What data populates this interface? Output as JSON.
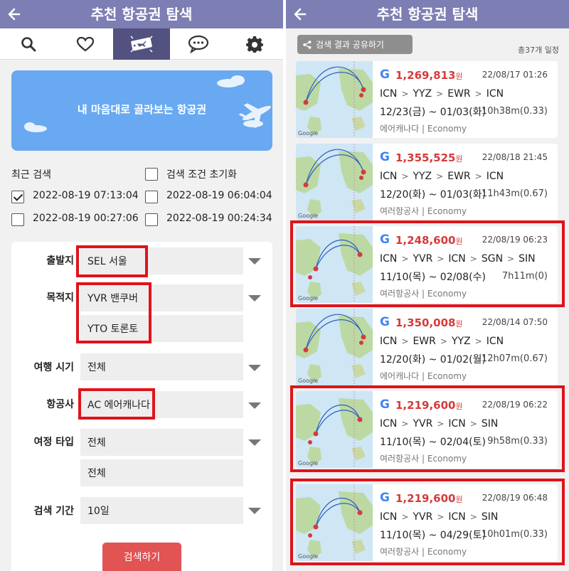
{
  "left": {
    "header_title": "추천 항공권 탐색",
    "banner_text": "내 마음대로 골라보는 항공권",
    "recent_label": "최근 검색",
    "reset_label": "검색 조건 초기화",
    "recent": [
      {
        "text": "2022-08-19 07:13:04",
        "checked": true
      },
      {
        "text": "2022-08-19 06:04:04",
        "checked": false
      },
      {
        "text": "2022-08-19 00:27:06",
        "checked": false
      },
      {
        "text": "2022-08-19 00:24:34",
        "checked": false
      }
    ],
    "form": {
      "origin_label": "출발지",
      "origin_value": "SEL 서울",
      "dest_label": "목적지",
      "dest_value_1": "YVR 밴쿠버",
      "dest_value_2": "YTO 토론토",
      "time_label": "여행 시기",
      "time_value": "전체",
      "airline_label": "항공사",
      "airline_value": "AC 에어캐나다",
      "triptype_label": "여정 타입",
      "triptype_value_1": "전체",
      "triptype_value_2": "전체",
      "period_label": "검색 기간",
      "period_value": "10일",
      "search_button": "검색하기"
    }
  },
  "right": {
    "header_title": "추천 항공권 탐색",
    "share_label": "검색 결과 공유하기",
    "total_label": "총37개 일정",
    "results": [
      {
        "price": "1,269,813",
        "won": "원",
        "date": "22/08/17 01:26",
        "route": [
          "ICN",
          "YYZ",
          "EWR",
          "ICN"
        ],
        "period": "12/23(금) ~ 01/03(화)",
        "duration": "10h38m(0.33)",
        "airline": "에어캐나다 | Economy",
        "highlight": false
      },
      {
        "price": "1,355,525",
        "won": "원",
        "date": "22/08/18 21:45",
        "route": [
          "ICN",
          "YYZ",
          "EWR",
          "ICN"
        ],
        "period": "12/20(화) ~ 01/03(화)",
        "duration": "11h43m(0.67)",
        "airline": "여러항공사 | Economy",
        "highlight": false
      },
      {
        "price": "1,248,600",
        "won": "원",
        "date": "22/08/19 06:23",
        "route": [
          "ICN",
          "YVR",
          "ICN",
          "SGN",
          "SIN"
        ],
        "period": "11/10(목) ~ 02/08(수)",
        "duration": "7h11m(0)",
        "airline": "여러항공사 | Economy",
        "highlight": true
      },
      {
        "price": "1,350,008",
        "won": "원",
        "date": "22/08/14 07:50",
        "route": [
          "ICN",
          "EWR",
          "YYZ",
          "ICN"
        ],
        "period": "12/20(화) ~ 01/02(월)",
        "duration": "12h07m(0.67)",
        "airline": "에어캐나다 | Economy",
        "highlight": false
      },
      {
        "price": "1,219,600",
        "won": "원",
        "date": "22/08/19 06:22",
        "route": [
          "ICN",
          "YVR",
          "ICN",
          "SIN"
        ],
        "period": "11/10(목) ~ 02/04(토)",
        "duration": "9h58m(0.33)",
        "airline": "여러항공사 | Economy",
        "highlight": true
      },
      {
        "price": "1,219,600",
        "won": "원",
        "date": "22/08/19 06:48",
        "route": [
          "ICN",
          "YVR",
          "ICN",
          "SIN"
        ],
        "period": "11/10(목) ~ 04/29(토)",
        "duration": "10h01m(0.33)",
        "airline": "여러항공사 | Economy",
        "highlight": true
      }
    ],
    "google_tag": "Google"
  },
  "colors": {
    "header": "#7d7eb3",
    "active_tab": "#53517f",
    "banner": "#69a9f1",
    "price": "#d63a3a",
    "highlight": "#e0131b",
    "search_button": "#e25353"
  },
  "icons": [
    "back-arrow-icon",
    "search-icon",
    "heart-icon",
    "ticket-icon",
    "chat-icon",
    "gear-icon",
    "share-icon",
    "google-icon"
  ]
}
